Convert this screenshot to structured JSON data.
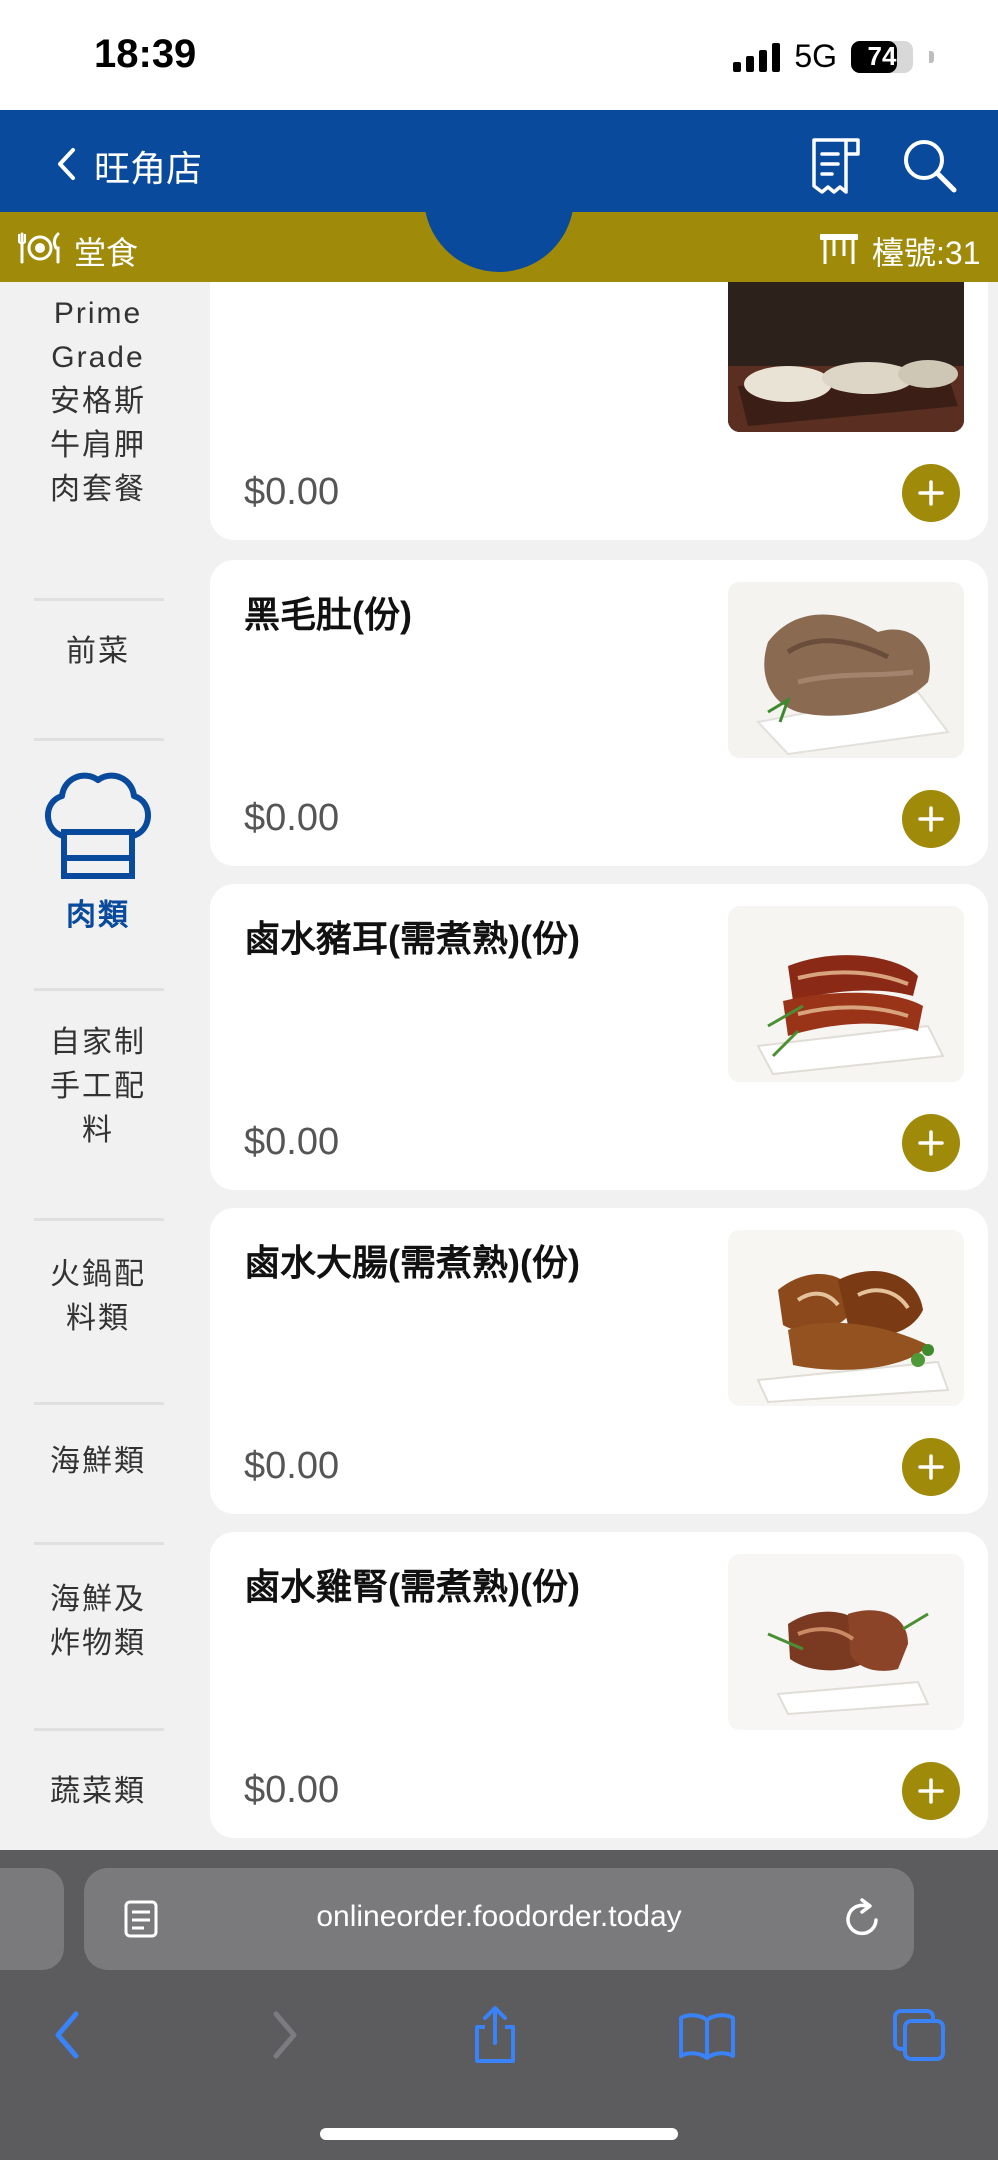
{
  "status_bar": {
    "time": "18:39",
    "network": "5G",
    "battery": "74",
    "battery_level": 0.74
  },
  "header": {
    "store_name": "旺角店"
  },
  "mode_bar": {
    "dine_in_label": "堂食",
    "table_label": "檯號:31"
  },
  "sidebar": {
    "categories": [
      {
        "label": "Prime Grade 安格斯牛肩胛肉套餐"
      },
      {
        "label": "前菜"
      },
      {
        "label": "肉類",
        "active": true
      },
      {
        "label": "自家制手工配料"
      },
      {
        "label": "火鍋配料類"
      },
      {
        "label": "海鮮類"
      },
      {
        "label": "海鮮及炸物類"
      },
      {
        "label": "蔬菜類"
      }
    ]
  },
  "section": {
    "title": "肉類"
  },
  "items": [
    {
      "name": "",
      "price": "$0.00"
    },
    {
      "name": "黑毛肚(份)",
      "price": "$0.00"
    },
    {
      "name": "鹵水豬耳(需煮熟)(份)",
      "price": "$0.00"
    },
    {
      "name": "鹵水大腸(需煮熟)(份)",
      "price": "$0.00"
    },
    {
      "name": "鹵水雞腎(需煮熟)(份)",
      "price": "$0.00"
    }
  ],
  "browser": {
    "url": "onlineorder.foodorder.today"
  },
  "colors": {
    "primary_blue": "#0a4a9c",
    "accent_gold": "#a08a0a",
    "browser_blue": "#3a82f7"
  }
}
